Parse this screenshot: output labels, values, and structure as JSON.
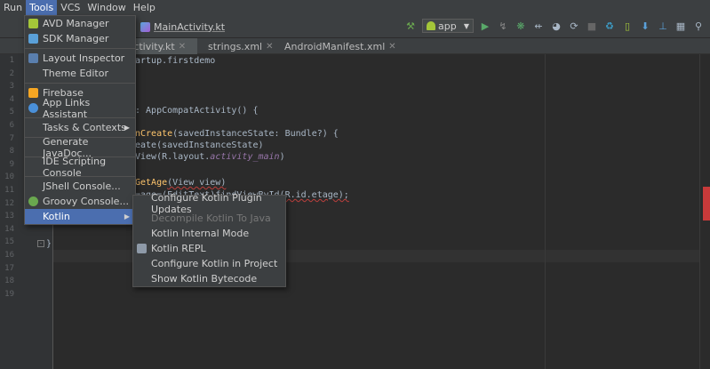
{
  "menubar": {
    "items": [
      "Run",
      "Tools",
      "VCS",
      "Window",
      "Help"
    ]
  },
  "toolbar": {
    "breadcrumb": "MainActivity.kt",
    "run_config": "app"
  },
  "tabs": [
    {
      "label": "nActivity.kt"
    },
    {
      "label": "strings.xml"
    },
    {
      "label": "AndroidManifest.xml"
    }
  ],
  "gutter": {
    "line_numbers": [
      "1",
      "2",
      "3",
      "4",
      "5",
      "6",
      "7",
      "8",
      "9",
      "10",
      "11",
      "12",
      "13",
      "14",
      "15",
      "16",
      "17",
      "18",
      "19"
    ]
  },
  "code": {
    "line1": "artup.firstdemo",
    "line2": ": AppCompatActivity() {",
    "line3a": "nCreate",
    "line3b": "(savedInstanceState: Bundle?) {",
    "line4": "eate(savedInstanceState)",
    "line5a": "View(R.layout.",
    "line5b": "activity_main",
    "line5c": ")",
    "line6a": "GetAge",
    "line6b": "(View view)",
    "line7": "=age=(EditText)findViewById(R.id.etage);",
    "line8": "}",
    "line9": "}"
  },
  "tools_menu": {
    "items": [
      {
        "label": "AVD Manager",
        "icon": "avd-icon"
      },
      {
        "label": "SDK Manager",
        "icon": "sdk-icon"
      },
      {
        "label": "Layout Inspector",
        "icon": "layout-inspector-icon"
      },
      {
        "label": "Theme Editor",
        "icon": ""
      },
      {
        "label": "Firebase",
        "icon": "firebase-icon"
      },
      {
        "label": "App Links Assistant",
        "icon": "app-links-icon"
      },
      {
        "label": "Tasks & Contexts",
        "icon": ""
      },
      {
        "label": "Generate JavaDoc...",
        "icon": ""
      },
      {
        "label": "IDE Scripting Console",
        "icon": ""
      },
      {
        "label": "JShell Console...",
        "icon": ""
      },
      {
        "label": "Groovy Console...",
        "icon": "groovy-icon"
      },
      {
        "label": "Kotlin",
        "icon": ""
      }
    ]
  },
  "kotlin_menu": {
    "items": [
      {
        "label": "Configure Kotlin Plugin Updates"
      },
      {
        "label": "Decompile Kotlin To Java"
      },
      {
        "label": "Kotlin Internal Mode"
      },
      {
        "label": "Kotlin REPL"
      },
      {
        "label": "Configure Kotlin in Project"
      },
      {
        "label": "Show Kotlin Bytecode"
      }
    ]
  },
  "colors": {
    "selection": "#4b6eaf",
    "background": "#2b2b2b",
    "panel": "#3c3f41",
    "error": "#c83a3a"
  }
}
